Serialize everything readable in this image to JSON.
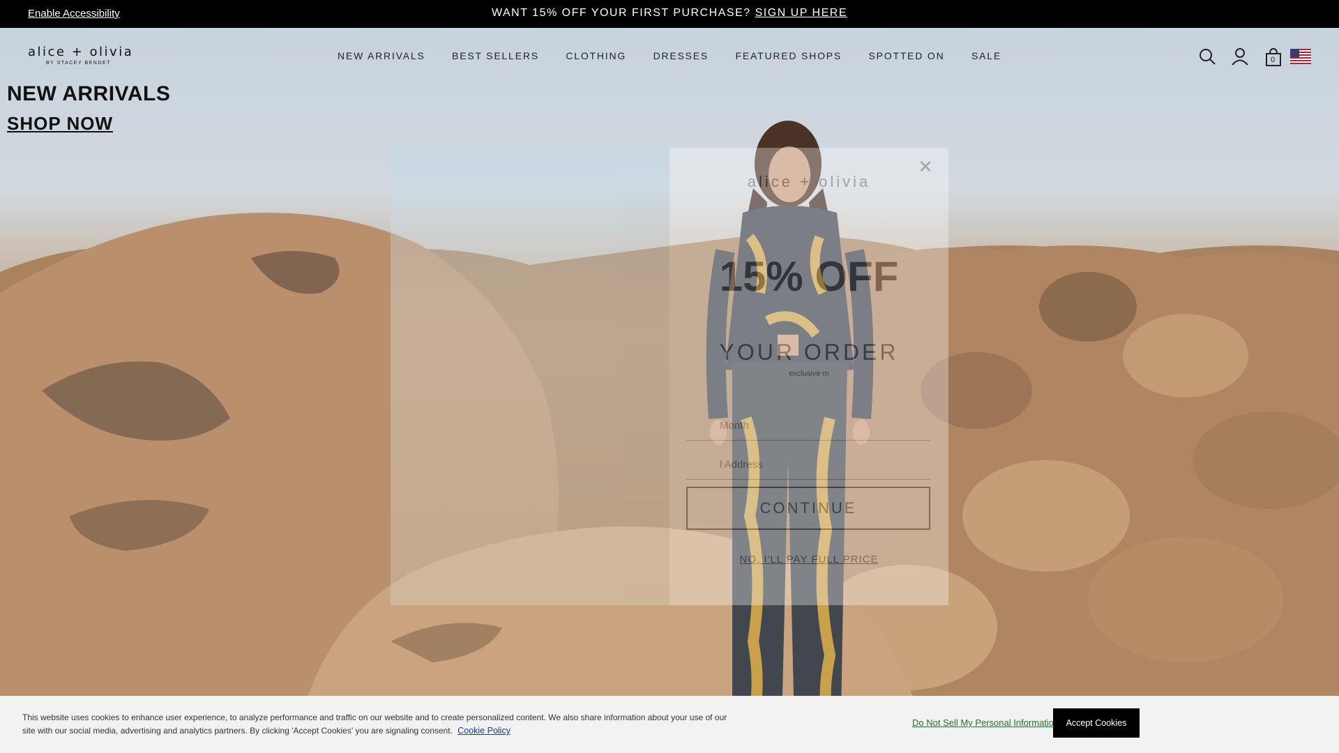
{
  "promo_bar": {
    "accessibility_link": "Enable Accessibility",
    "message": "WANT 15% OFF YOUR FIRST PURCHASE?",
    "signup_link": "SIGN UP HERE"
  },
  "header": {
    "logo_main": "alice + olivia",
    "logo_sub": "BY STACEY BENDET",
    "nav": [
      "NEW ARRIVALS",
      "BEST SELLERS",
      "CLOTHING",
      "DRESSES",
      "FEATURED SHOPS",
      "SPOTTED ON",
      "SALE"
    ],
    "cart_count": "0",
    "icons": [
      "search-icon",
      "account-icon",
      "cart-icon",
      "us-flag-icon"
    ]
  },
  "hero": {
    "title": "NEW ARRIVALS",
    "cta": "SHOP NOW"
  },
  "modal": {
    "logo": "alice + olivia",
    "headline": "15% OFF",
    "subheadline": "YOUR ORDER",
    "small_text": "exclusive m",
    "field_1_placeholder": "Month",
    "field_2_placeholder": "l Address",
    "button": "CONTINUE",
    "decline": "NO, I'LL PAY FULL PRICE"
  },
  "cookie_banner": {
    "text": "This website uses cookies to enhance user experience, to analyze performance and traffic on our website and to create personalized content. We also share information about your use of our site with our social media, advertising and analytics partners. By clicking 'Accept Cookies' you are signaling consent.",
    "policy_link": "Cookie Policy",
    "do_not_sell": "Do Not Sell My Personal Information",
    "accept": "Accept Cookies"
  },
  "colors": {
    "promo_bg": "#000000",
    "cookie_accent": "#2d6a2f",
    "outfit_gold": "#c9a14a",
    "outfit_denim": "#3a3f47"
  }
}
